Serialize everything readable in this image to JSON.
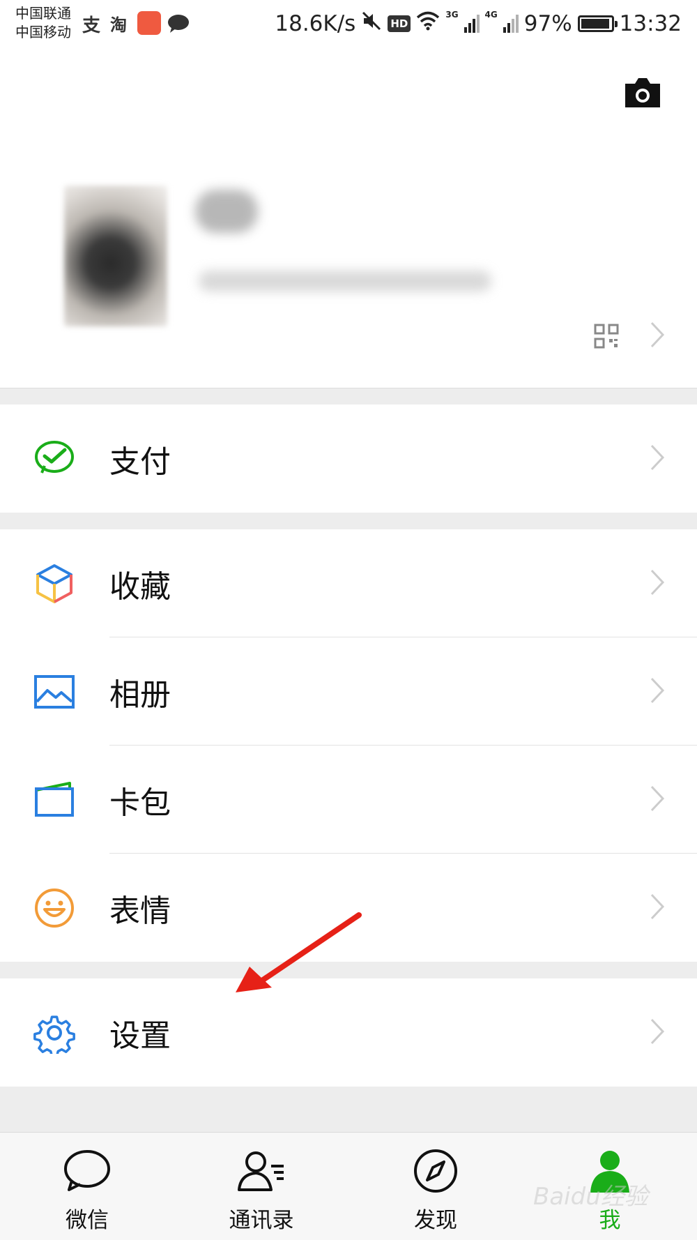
{
  "status_bar": {
    "carrier_1": "中国联通",
    "carrier_2": "中国移动",
    "app_zhi": "支",
    "app_tao": "淘",
    "net_speed": "18.6K/s",
    "hd": "HD",
    "net_3g": "3G",
    "net_4g": "4G",
    "battery_percent": "97%",
    "battery_level": 0.97,
    "time": "13:32"
  },
  "menu": {
    "pay": "支付",
    "favorites": "收藏",
    "album": "相册",
    "cards": "卡包",
    "stickers": "表情",
    "settings": "设置"
  },
  "tabs": [
    {
      "label": "微信"
    },
    {
      "label": "通讯录"
    },
    {
      "label": "发现"
    },
    {
      "label": "我"
    }
  ],
  "colors": {
    "accent_green": "#1aad19",
    "arrow_red": "#e62117",
    "settings_blue": "#2a7fe0"
  },
  "watermark": "Baidu经验"
}
